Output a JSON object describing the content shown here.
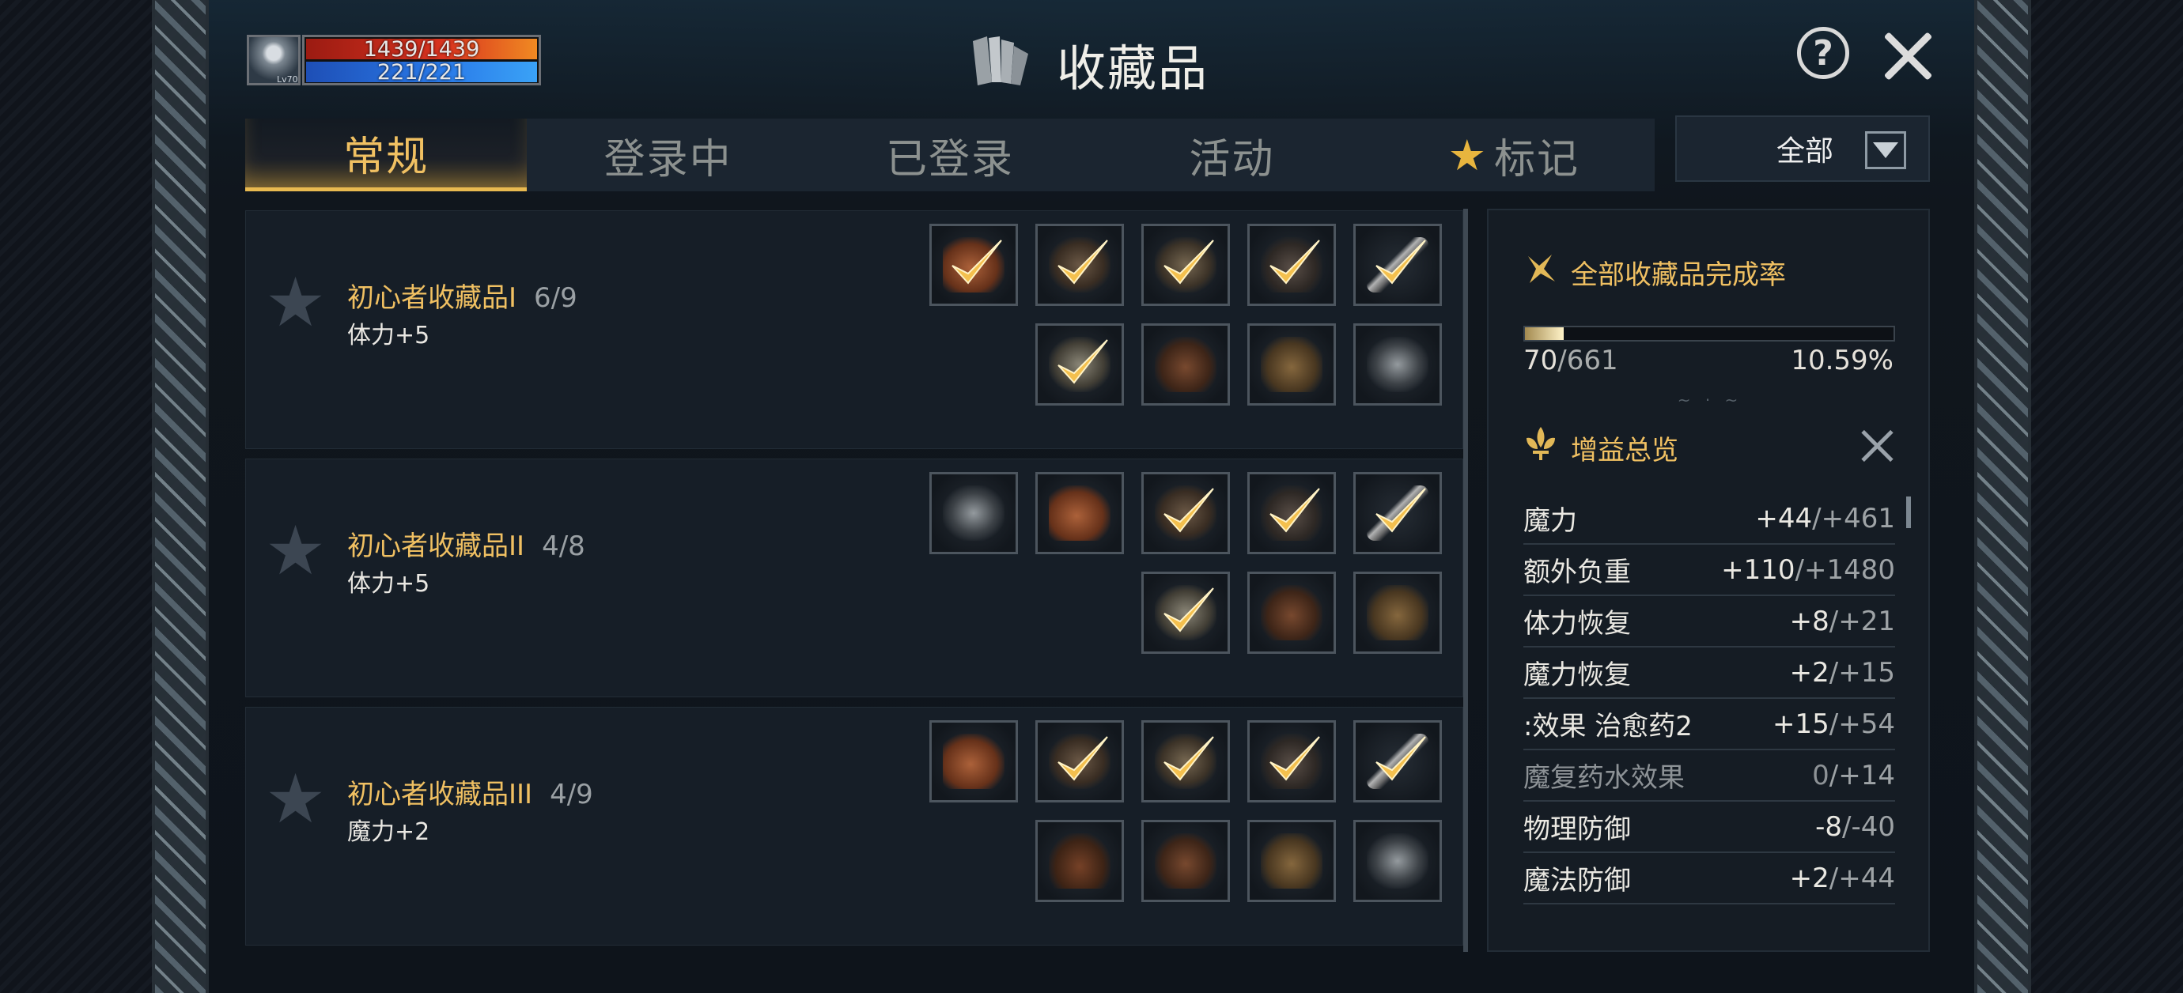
{
  "player": {
    "hp": "1439/1439",
    "mp": "221/221",
    "level": "Lv70"
  },
  "header": {
    "title": "收藏品",
    "title_icon": "books-icon",
    "help_icon": "question-circle-icon",
    "close_icon": "close-icon"
  },
  "tabs": [
    {
      "label": "常规",
      "active": true
    },
    {
      "label": "登录中",
      "active": false
    },
    {
      "label": "已登录",
      "active": false
    },
    {
      "label": "活动",
      "active": false
    },
    {
      "label": "标记",
      "active": false,
      "icon": "star-icon"
    }
  ],
  "filter": {
    "selected": "全部"
  },
  "collections": [
    {
      "name": "初心者收藏品I",
      "count": "6/9",
      "bonus": "体力+5",
      "slots": [
        {
          "item": "gloves",
          "checked": true
        },
        {
          "item": "chest-armor",
          "checked": true
        },
        {
          "item": "gauntlet",
          "checked": true
        },
        {
          "item": "horned-helm",
          "checked": true
        },
        {
          "item": "sword",
          "checked": true
        },
        {
          "item": "belt",
          "checked": true
        },
        {
          "item": "boots",
          "checked": false
        },
        {
          "item": "pouch",
          "checked": false
        },
        {
          "item": "robe",
          "checked": false
        }
      ]
    },
    {
      "name": "初心者收藏品II",
      "count": "4/8",
      "bonus": "体力+5",
      "slots": [
        {
          "item": "robe",
          "checked": false
        },
        {
          "item": "gloves",
          "checked": false
        },
        {
          "item": "chest-armor",
          "checked": true
        },
        {
          "item": "horned-helm",
          "checked": true
        },
        {
          "item": "sword",
          "checked": true
        },
        {
          "item": "belt",
          "checked": true
        },
        {
          "item": "boots",
          "checked": false
        },
        {
          "item": "pouch",
          "checked": false
        }
      ]
    },
    {
      "name": "初心者收藏品III",
      "count": "4/9",
      "bonus": "魔力+2",
      "slots": [
        {
          "item": "gloves",
          "checked": false
        },
        {
          "item": "chest-armor",
          "checked": true
        },
        {
          "item": "gauntlet",
          "checked": true
        },
        {
          "item": "horned-helm",
          "checked": true
        },
        {
          "item": "sword",
          "checked": true
        },
        {
          "item": "cloak",
          "checked": false
        },
        {
          "item": "boots",
          "checked": false
        },
        {
          "item": "pouch",
          "checked": false
        },
        {
          "item": "robe",
          "checked": false
        }
      ]
    }
  ],
  "completion": {
    "title": "全部收藏品完成率",
    "current": "70",
    "total": "/661",
    "percent": "10.59%",
    "fraction": 0.1059
  },
  "buffs": {
    "title": "增益总览",
    "items": [
      {
        "name": "魔力",
        "value": "+44",
        "max": "/+461",
        "dim": false
      },
      {
        "name": "额外负重",
        "value": "+110",
        "max": "/+1480",
        "dim": false
      },
      {
        "name": "体力恢复",
        "value": "+8",
        "max": "/+21",
        "dim": false
      },
      {
        "name": "魔力恢复",
        "value": "+2",
        "max": "/+15",
        "dim": false
      },
      {
        "name": ":效果    治愈药2",
        "value": "+15",
        "max": "/+54",
        "dim": false
      },
      {
        "name": "魔复药水效果",
        "value": "0",
        "max": "/+14",
        "dim": true
      },
      {
        "name": "物理防御",
        "value": "-8",
        "max": "/-40",
        "dim": false
      },
      {
        "name": "魔法防御",
        "value": "+2",
        "max": "/+44",
        "dim": false
      }
    ]
  },
  "colors": {
    "accent_gold": "#f0c062",
    "hp": "#d9331f",
    "mp": "#2a7be9",
    "panel": "#161e27"
  }
}
